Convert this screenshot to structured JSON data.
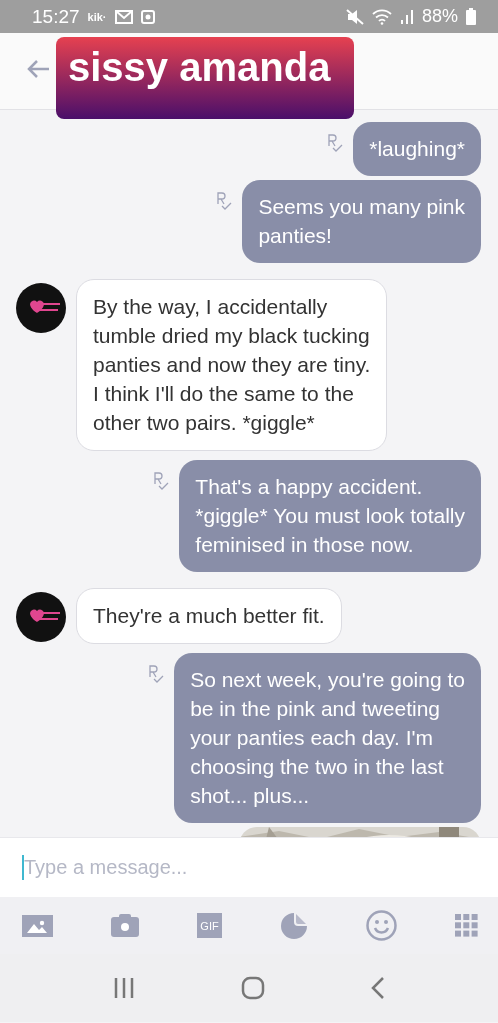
{
  "status_bar": {
    "time": "15:27",
    "app_label": "kik·",
    "battery": "88%"
  },
  "header": {
    "title": "sissy amanda"
  },
  "messages": [
    {
      "kind": "text",
      "outgoing": true,
      "text": "*laughing*"
    },
    {
      "kind": "text",
      "outgoing": true,
      "text": "Seems you many pink\npanties!"
    },
    {
      "kind": "text",
      "outgoing": false,
      "text": "By the way, I accidentally\ntumble dried my black tucking\npanties and now they are tiny.\nI think I'll do the same to the\nother two pairs. *giggle*"
    },
    {
      "kind": "text",
      "outgoing": true,
      "text": "That's a happy accident.\n*giggle* You must look totally\nfeminised in those now."
    },
    {
      "kind": "text",
      "outgoing": false,
      "text": "They're a much better fit."
    },
    {
      "kind": "text",
      "outgoing": true,
      "text": "So next week, you're going to\nbe in the pink and tweeting\nyour panties each day. I'm\nchoosing the two in the last\nshot... plus..."
    },
    {
      "kind": "picture",
      "outgoing": true
    }
  ],
  "composer": {
    "placeholder": "Type a message..."
  },
  "toolbar": {
    "gif_label": "GIF"
  }
}
